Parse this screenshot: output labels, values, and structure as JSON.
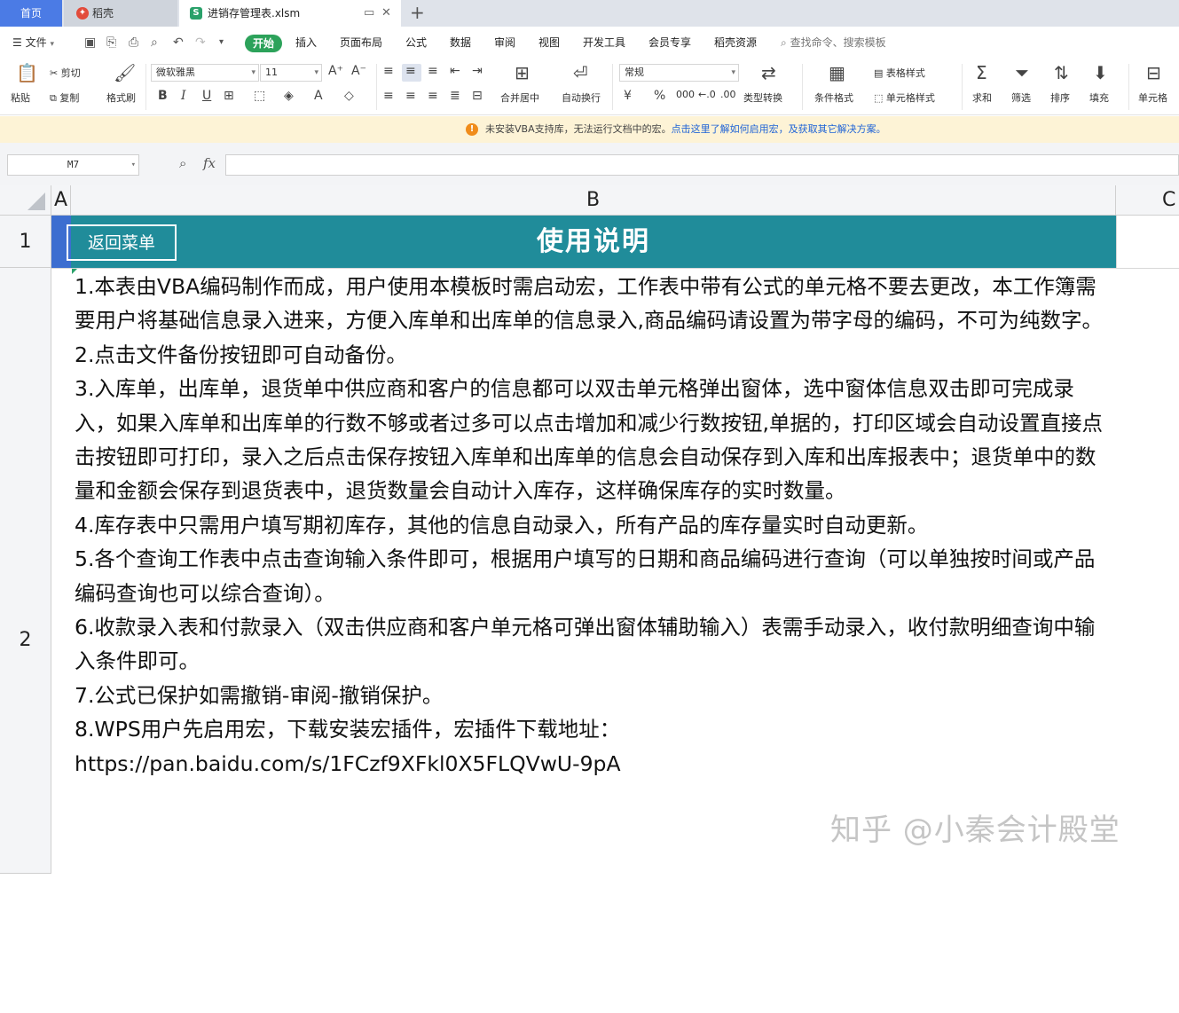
{
  "tabs": {
    "home": "首页",
    "daoke": "稻壳",
    "file": "进销存管理表.xlsm",
    "add": "+"
  },
  "menubar": {
    "file_menu": "文件",
    "items": [
      "开始",
      "插入",
      "页面布局",
      "公式",
      "数据",
      "审阅",
      "视图",
      "开发工具",
      "会员专享",
      "稻壳资源"
    ],
    "search": "查找命令、搜索模板"
  },
  "ribbon": {
    "paste": "粘贴",
    "cut": "剪切",
    "copy": "复制",
    "format_painter": "格式刷",
    "font_name": "微软雅黑",
    "font_size": "11",
    "merge_center": "合并居中",
    "wrap_text": "自动换行",
    "number_format": "常规",
    "type_convert": "类型转换",
    "conditional_format": "条件格式",
    "table_style": "表格样式",
    "cell_style": "单元格样式",
    "sum": "求和",
    "filter": "筛选",
    "sort": "排序",
    "fill": "填充",
    "cell": "单元格",
    "percent": "%",
    "thousands": "000",
    "currency": "¥"
  },
  "notice": {
    "text": "未安装VBA支持库，无法运行文档中的宏。",
    "link": "点击这里了解如何启用宏，及获取其它解决方案。"
  },
  "formula_bar": {
    "name_box": "M7",
    "fx": "fx",
    "value": ""
  },
  "sheet": {
    "columns": [
      "A",
      "B",
      "C"
    ],
    "rows": [
      "1",
      "2"
    ],
    "back_button": "返回菜单",
    "title": "使用说明",
    "lines": [
      "1.本表由VBA编码制作而成，用户使用本模板时需启动宏，工作表中带有公式的单元格不要去更改，本工作簿需要用户将基础信息录入进来，方便入库单和出库单的信息录入,商品编码请设置为带字母的编码，不可为纯数字。",
      "2.点击文件备份按钮即可自动备份。",
      "3.入库单，出库单，退货单中供应商和客户的信息都可以双击单元格弹出窗体，选中窗体信息双击即可完成录入，如果入库单和出库单的行数不够或者过多可以点击增加和减少行数按钮,单据的，打印区域会自动设置直接点击按钮即可打印，录入之后点击保存按钮入库单和出库单的信息会自动保存到入库和出库报表中；退货单中的数量和金额会保存到退货表中，退货数量会自动计入库存，这样确保库存的实时数量。",
      "4.库存表中只需用户填写期初库存，其他的信息自动录入，所有产品的库存量实时自动更新。",
      "5.各个查询工作表中点击查询输入条件即可，根据用户填写的日期和商品编码进行查询（可以单独按时间或产品编码查询也可以综合查询）。",
      "6.收款录入表和付款录入（双击供应商和客户单元格可弹出窗体辅助输入）表需手动录入，收付款明细查询中输入条件即可。",
      "7.公式已保护如需撤销-审阅-撤销保护。",
      "8.WPS用户先启用宏，下载安装宏插件，宏插件下载地址：",
      "https://pan.baidu.com/s/1FCzf9XFkl0X5FLQVwU-9pA"
    ]
  },
  "watermark": "知乎 @小秦会计殿堂",
  "colors": {
    "banner": "#208c9a",
    "home_tab": "#4b7be5",
    "active_menu": "#2ca25a",
    "notice_bg": "#fdf3d6"
  }
}
